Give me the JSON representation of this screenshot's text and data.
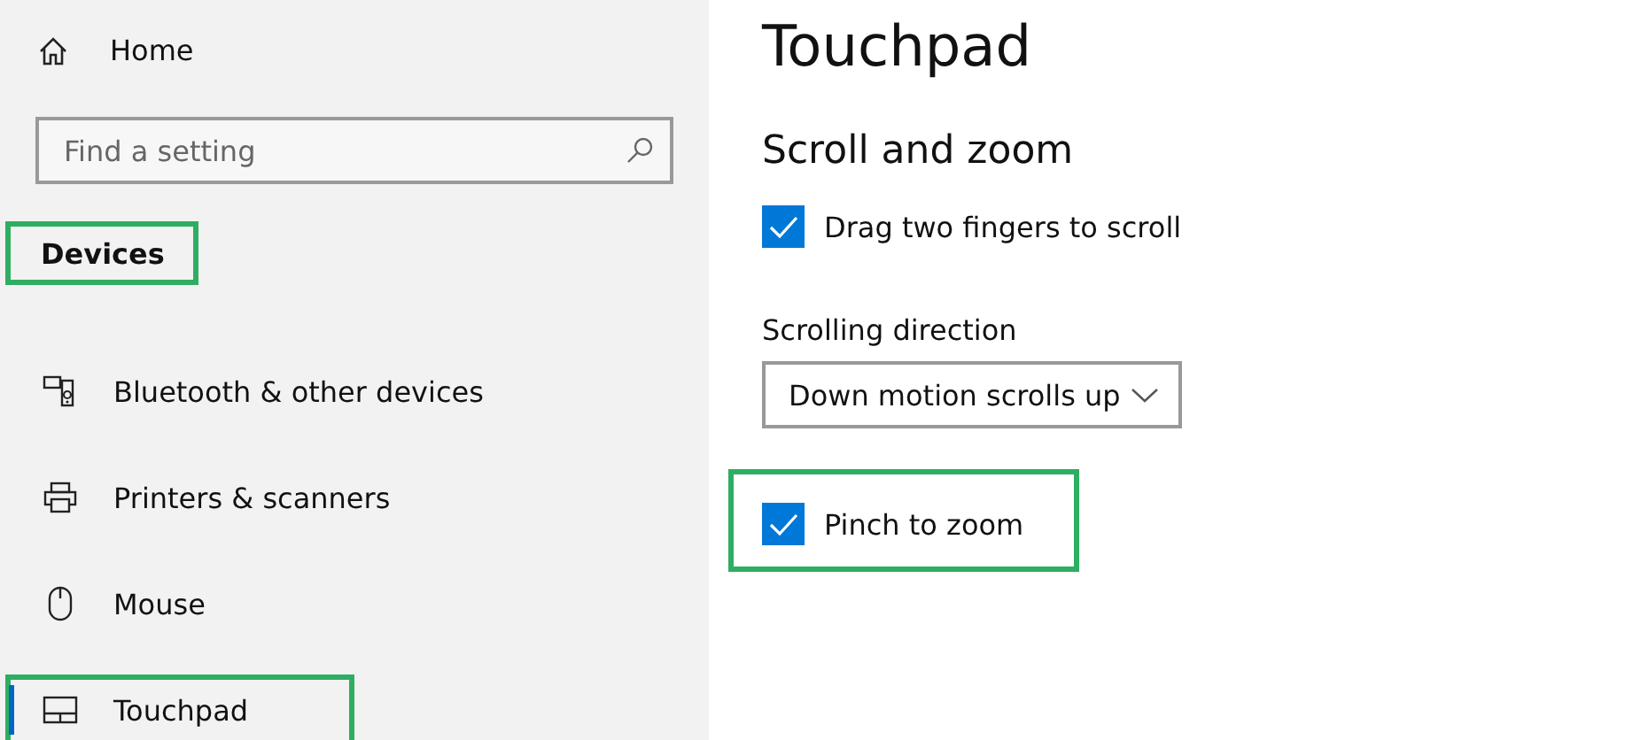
{
  "sidebar": {
    "home": {
      "label": "Home"
    },
    "search": {
      "placeholder": "Find a setting"
    },
    "section": {
      "label": "Devices",
      "highlighted": true
    },
    "items": [
      {
        "kind": "bluetooth",
        "label": "Bluetooth & other devices",
        "selected": false,
        "highlighted": false
      },
      {
        "kind": "printer",
        "label": "Printers & scanners",
        "selected": false,
        "highlighted": false
      },
      {
        "kind": "mouse",
        "label": "Mouse",
        "selected": false,
        "highlighted": false
      },
      {
        "kind": "touchpad",
        "label": "Touchpad",
        "selected": true,
        "highlighted": true
      }
    ]
  },
  "page": {
    "title": "Touchpad",
    "section_title": "Scroll and zoom",
    "settings": [
      {
        "kind": "checkbox",
        "label": "Drag two fingers to scroll",
        "checked": true,
        "highlighted": false
      },
      {
        "kind": "dropdown",
        "label": "Scrolling direction",
        "value": "Down motion scrolls up",
        "highlighted": false
      },
      {
        "kind": "checkbox",
        "label": "Pinch to zoom",
        "checked": true,
        "highlighted": true
      }
    ]
  }
}
